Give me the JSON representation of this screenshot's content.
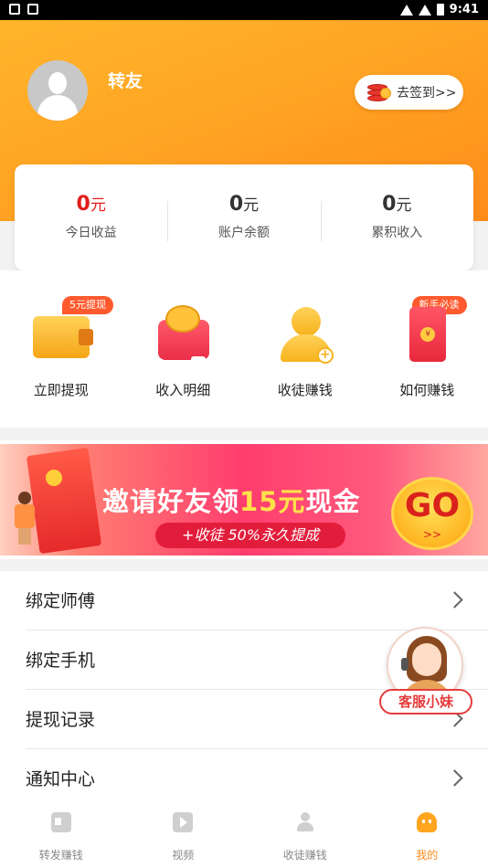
{
  "status_bar": {
    "time": "9:41"
  },
  "profile": {
    "username": "转友",
    "signin_label": "去签到>>"
  },
  "earnings": [
    {
      "value": "0",
      "unit": "元",
      "label": "今日收益"
    },
    {
      "value": "0",
      "unit": "元",
      "label": "账户余额"
    },
    {
      "value": "0",
      "unit": "元",
      "label": "累积收入"
    }
  ],
  "quick_actions": [
    {
      "label": "立即提现",
      "badge": "5元提现",
      "icon": "wallet-icon"
    },
    {
      "label": "收入明细",
      "badge": "",
      "icon": "purse-icon"
    },
    {
      "label": "收徒赚钱",
      "badge": "",
      "icon": "add-friend-icon"
    },
    {
      "label": "如何赚钱",
      "badge": "新手必读",
      "icon": "red-envelope-icon"
    }
  ],
  "banner": {
    "title_prefix": "邀请好友领",
    "title_highlight": "15元",
    "title_suffix": "现金",
    "subtitle": "+收徒 50%永久提成",
    "go_label": "GO",
    "go_arrows": ">>"
  },
  "menu": [
    {
      "label": "绑定师傅"
    },
    {
      "label": "绑定手机"
    },
    {
      "label": "提现记录"
    },
    {
      "label": "通知中心"
    }
  ],
  "service": {
    "label": "客服小妹"
  },
  "tabs": [
    {
      "label": "转发赚钱",
      "active": false
    },
    {
      "label": "视频",
      "active": false
    },
    {
      "label": "收徒赚钱",
      "active": false
    },
    {
      "label": "我的",
      "active": true
    }
  ],
  "colors": {
    "accent": "#ff8a1a",
    "header_start": "#ffb52a",
    "header_end": "#ff8c1a",
    "earn_red": "#e31c1c",
    "badge": "#ff5a2e"
  }
}
